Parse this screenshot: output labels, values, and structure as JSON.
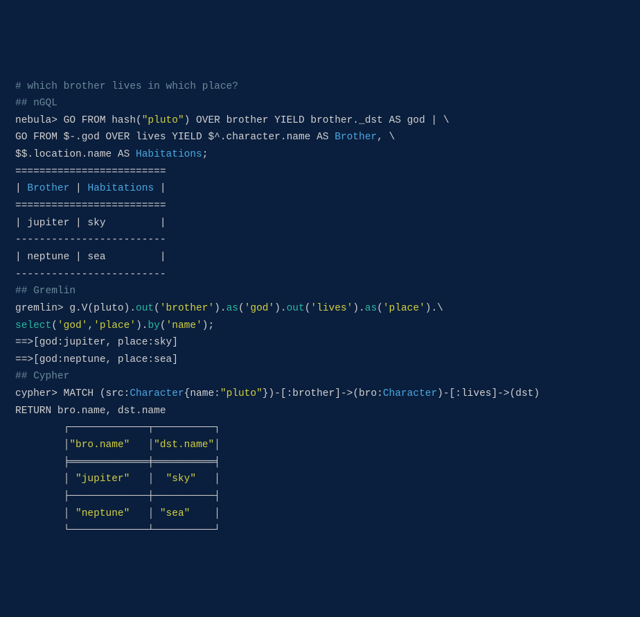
{
  "comments": {
    "title": "# which brother lives in which place?",
    "ngql": "## nGQL",
    "gremlin": "## Gremlin",
    "cypher": "## Cypher"
  },
  "ngql": {
    "l1_a": "nebula> GO FROM hash(",
    "l1_b": "\"pluto\"",
    "l1_c": ") OVER brother YIELD brother._dst AS god | \\",
    "l2_a": "GO FROM $-.god OVER lives YIELD $^.character.name AS ",
    "l2_b": "Brother",
    "l2_c": ", \\",
    "l3_a": "$$.location.name AS ",
    "l3_b": "Habitations",
    "l3_c": ";",
    "table_top": "=========================",
    "header_a": "| ",
    "header_b": "Brother",
    "header_c": " | ",
    "header_d": "Habitations",
    "header_e": " |",
    "row_sep": "-------------------------",
    "row1": "| jupiter | sky         |",
    "row2": "| neptune | sea         |"
  },
  "gremlin": {
    "l1_a": "gremlin> g.V(pluto).",
    "l1_out1": "out",
    "l1_p1": "(",
    "l1_s1": "'brother'",
    "l1_p2": ").",
    "l1_as1": "as",
    "l1_p3": "(",
    "l1_s2": "'god'",
    "l1_p4": ").",
    "l1_out2": "out",
    "l1_p5": "(",
    "l1_s3": "'lives'",
    "l1_p6": ").",
    "l1_as2": "as",
    "l1_p7": "(",
    "l1_s4": "'place'",
    "l1_p8": ").\\",
    "l2_sel": "select",
    "l2_a": "(",
    "l2_s1": "'god'",
    "l2_b": ",",
    "l2_s2": "'place'",
    "l2_c": ").",
    "l2_by": "by",
    "l2_d": "(",
    "l2_s3": "'name'",
    "l2_e": ");",
    "r1": "==>[god:jupiter, place:sky]",
    "r2": "==>[god:neptune, place:sea]"
  },
  "cypher": {
    "l1_a": "cypher> MATCH (src:",
    "l1_b": "Character",
    "l1_c": "{name:",
    "l1_d": "\"pluto\"",
    "l1_e": "})-[:brother]->(bro:",
    "l1_f": "Character",
    "l1_g": ")-[:lives]->(dst)",
    "l2": "RETURN bro.name, dst.name",
    "t_top": "        ┌─────────────┬──────────┐",
    "h_a": "        │",
    "h_b": "\"bro.name\"",
    "h_c": "   │",
    "h_d": "\"dst.name\"",
    "h_e": "│",
    "t_mid": "        ╞═════════════╪══════════╡",
    "r1_a": "        │ ",
    "r1_b": "\"jupiter\"",
    "r1_c": "   │  ",
    "r1_d": "\"sky\"",
    "r1_e": "   │",
    "t_sep": "        ├─────────────┼──────────┤",
    "r2_a": "        │ ",
    "r2_b": "\"neptune\"",
    "r2_c": "   │ ",
    "r2_d": "\"sea\"",
    "r2_e": "    │",
    "t_bot": "        └─────────────┴──────────┘"
  }
}
